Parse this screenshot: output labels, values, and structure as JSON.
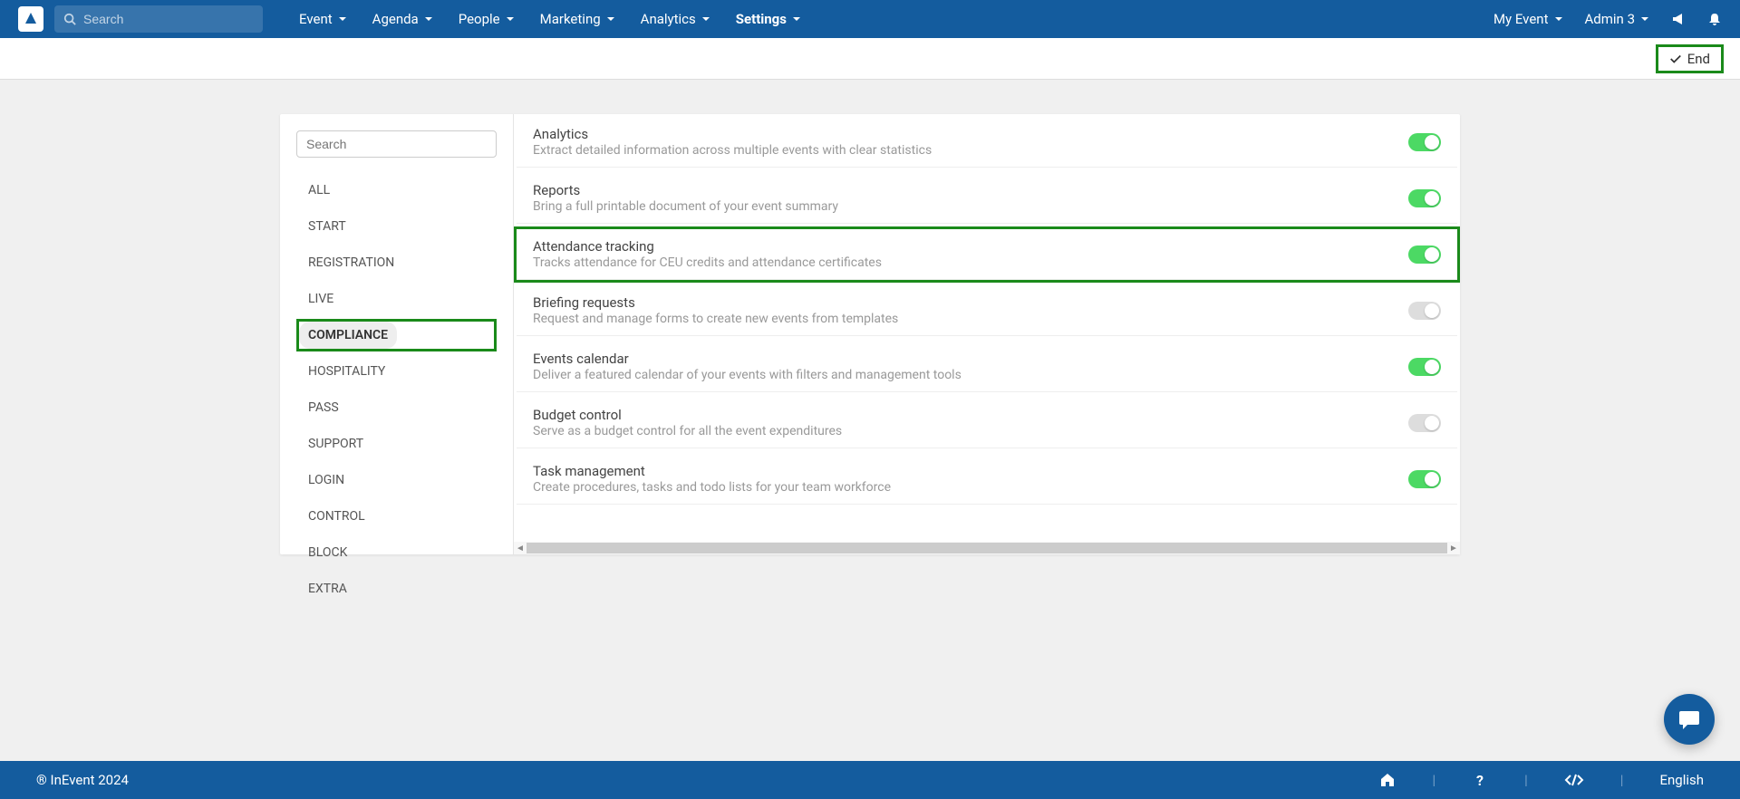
{
  "header": {
    "search_placeholder": "Search",
    "nav": [
      {
        "label": "Event"
      },
      {
        "label": "Agenda"
      },
      {
        "label": "People"
      },
      {
        "label": "Marketing"
      },
      {
        "label": "Analytics"
      },
      {
        "label": "Settings",
        "active": true
      }
    ],
    "event_selector": "My Event",
    "user_label": "Admin 3"
  },
  "subbar": {
    "end_label": "End"
  },
  "sidebar": {
    "search_placeholder": "Search",
    "items": [
      {
        "label": "ALL"
      },
      {
        "label": "START"
      },
      {
        "label": "REGISTRATION"
      },
      {
        "label": "LIVE"
      },
      {
        "label": "COMPLIANCE",
        "active": true,
        "highlight": true
      },
      {
        "label": "HOSPITALITY"
      },
      {
        "label": "PASS"
      },
      {
        "label": "SUPPORT"
      },
      {
        "label": "LOGIN"
      },
      {
        "label": "CONTROL"
      },
      {
        "label": "BLOCK"
      },
      {
        "label": "EXTRA"
      }
    ]
  },
  "settings": [
    {
      "title": "Analytics",
      "desc": "Extract detailed information across multiple events with clear statistics",
      "on": true
    },
    {
      "title": "Reports",
      "desc": "Bring a full printable document of your event summary",
      "on": true
    },
    {
      "title": "Attendance tracking",
      "desc": "Tracks attendance for CEU credits and attendance certificates",
      "on": true,
      "highlight": true
    },
    {
      "title": "Briefing requests",
      "desc": "Request and manage forms to create new events from templates",
      "on": false
    },
    {
      "title": "Events calendar",
      "desc": "Deliver a featured calendar of your events with filters and management tools",
      "on": true
    },
    {
      "title": "Budget control",
      "desc": "Serve as a budget control for all the event expenditures",
      "on": false
    },
    {
      "title": "Task management",
      "desc": "Create procedures, tasks and todo lists for your team workforce",
      "on": true
    }
  ],
  "footer": {
    "copyright": "® InEvent 2024",
    "language": "English"
  }
}
